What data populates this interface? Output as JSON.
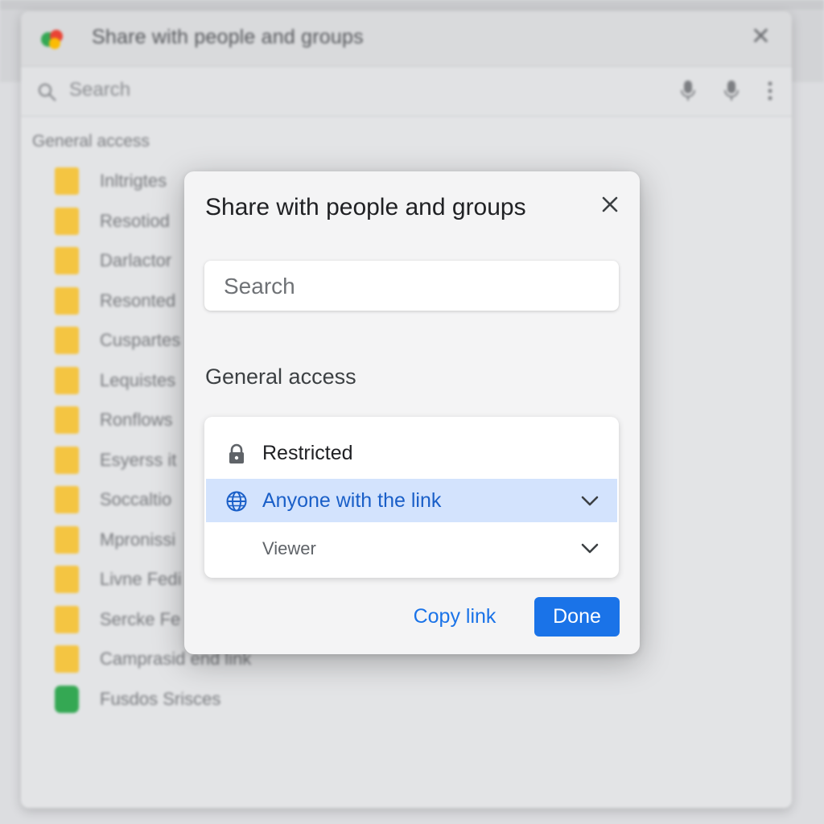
{
  "background_window": {
    "title": "Share with people and groups",
    "search_placeholder": "Search",
    "section_label": "General access",
    "files": [
      {
        "name": "Inltrigtes",
        "icon": "folder-icon"
      },
      {
        "name": "Resotiod",
        "icon": "folder-icon"
      },
      {
        "name": "Darlactor",
        "icon": "folder-icon"
      },
      {
        "name": "Resonted",
        "icon": "folder-icon"
      },
      {
        "name": "Cuspartes",
        "icon": "folder-icon"
      },
      {
        "name": "Lequistes",
        "icon": "folder-icon"
      },
      {
        "name": "Ronflows",
        "icon": "folder-icon"
      },
      {
        "name": "Esyerss it",
        "icon": "folder-icon"
      },
      {
        "name": "Soccaltio",
        "icon": "folder-icon"
      },
      {
        "name": "Mpronissi",
        "icon": "folder-icon"
      },
      {
        "name": "Livne Fedi",
        "icon": "folder-icon"
      },
      {
        "name": "Sercke Fe",
        "icon": "folder-icon"
      },
      {
        "name": "Camprasid end link",
        "icon": "folder-icon"
      },
      {
        "name": "Fusdos Srisces",
        "icon": "sheet-icon"
      }
    ]
  },
  "dialog": {
    "title": "Share with people and groups",
    "search_placeholder": "Search",
    "general_access_label": "General access",
    "access_options": [
      {
        "label": "Restricted",
        "icon": "lock-icon"
      },
      {
        "label": "Anyone with the link",
        "icon": "globe-icon",
        "selected": true
      }
    ],
    "role_label": "Viewer",
    "copy_link_label": "Copy link",
    "done_label": "Done"
  },
  "colors": {
    "accent": "#1a73e8",
    "selected_row": "#d3e3fd",
    "selected_text": "#1a5fc8",
    "folder": "#f4c542",
    "sheet": "#34a853"
  }
}
